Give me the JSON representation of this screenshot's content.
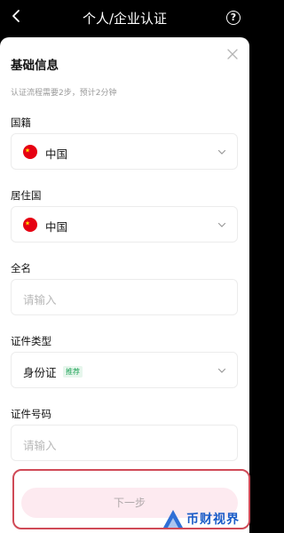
{
  "nav": {
    "title": "个人/企业认证",
    "help_glyph": "?"
  },
  "sheet": {
    "heading": "基础信息",
    "subtitle": "认证流程需要2步，预计2分钟"
  },
  "fields": {
    "nationality": {
      "label": "国籍",
      "value": "中国"
    },
    "residence": {
      "label": "居住国",
      "value": "中国"
    },
    "fullname": {
      "label": "全名",
      "placeholder": "请输入"
    },
    "id_type": {
      "label": "证件类型",
      "value": "身份证",
      "badge": "推荐"
    },
    "id_number": {
      "label": "证件号码",
      "placeholder": "请输入"
    }
  },
  "next_button": {
    "label": "下一步"
  },
  "watermark": {
    "text": "币财视界"
  },
  "colors": {
    "accent_badge": "#22a45a",
    "highlight": "#d04a57",
    "button_bg": "#fdeaf0",
    "watermark": "#1a5cc8"
  }
}
